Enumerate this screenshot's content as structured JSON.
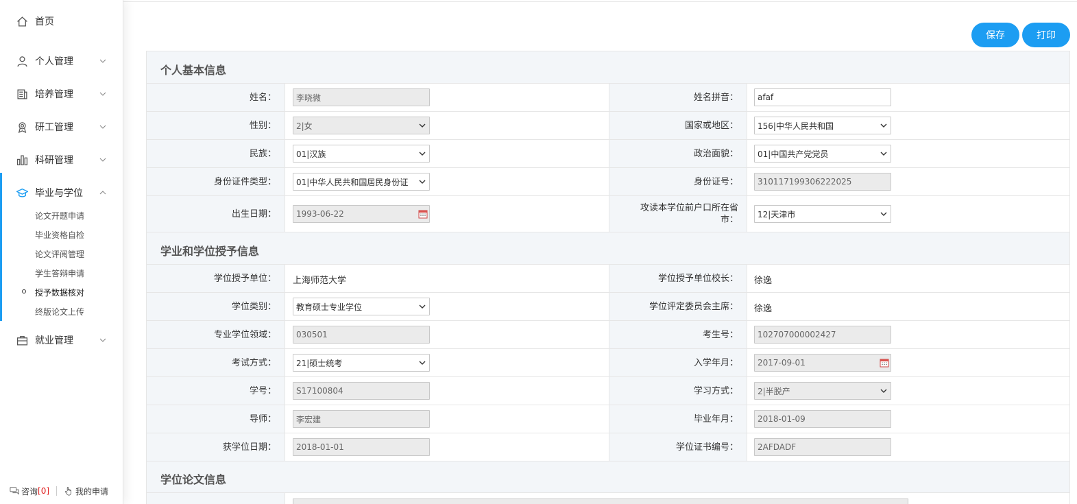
{
  "sidebar": {
    "home": "首页",
    "menus": [
      {
        "label": "个人管理",
        "icon": "user-icon"
      },
      {
        "label": "培养管理",
        "icon": "book-icon"
      },
      {
        "label": "研工管理",
        "icon": "award-icon"
      },
      {
        "label": "科研管理",
        "icon": "bar-chart-icon"
      },
      {
        "label": "毕业与学位",
        "icon": "graduation-cap-icon"
      },
      {
        "label": "就业管理",
        "icon": "briefcase-icon"
      }
    ],
    "sub_items": [
      "论文开题申请",
      "毕业资格自检",
      "论文评阅管理",
      "学生答辩申请",
      "授予数据核对",
      "终版论文上传"
    ],
    "active_sub": "授予数据核对",
    "footer": {
      "consult": "咨询",
      "consult_count": "[0]",
      "my_apply": "我的申请"
    }
  },
  "toolbar": {
    "save": "保存",
    "print": "打印"
  },
  "sections": {
    "basic": "个人基本信息",
    "degree": "学业和学位授予信息",
    "thesis": "学位论文信息"
  },
  "basic": {
    "name_label": "姓名：",
    "name": "李晓微",
    "pinyin_label": "姓名拼音：",
    "pinyin": "afaf",
    "gender_label": "性别：",
    "gender": "2|女",
    "country_label": "国家或地区：",
    "country": "156|中华人民共和国",
    "ethnic_label": "民族：",
    "ethnic": "01|汉族",
    "political_label": "政治面貌：",
    "political": "01|中国共产党党员",
    "idtype_label": "身份证件类型：",
    "idtype": "01|中华人民共和国居民身份证",
    "idno_label": "身份证号：",
    "idno": "310117199306222025",
    "birth_label": "出生日期：",
    "birth": "1993-06-22",
    "hukou_label": "攻读本学位前户口所在省市：",
    "hukou": "12|天津市"
  },
  "degree": {
    "unit_label": "学位授予单位：",
    "unit": "上海师范大学",
    "president_label": "学位授予单位校长：",
    "president": "徐逸",
    "type_label": "学位类别：",
    "type": "教育硕士专业学位",
    "chair_label": "学位评定委员会主席：",
    "chair": "徐逸",
    "field_label": "专业学位领域：",
    "field": "030501",
    "examno_label": "考生号：",
    "examno": "102707000002427",
    "exammode_label": "考试方式：",
    "exammode": "21|硕士统考",
    "enroll_label": "入学年月：",
    "enroll": "2017-09-01",
    "sid_label": "学号：",
    "sid": "S17100804",
    "studymode_label": "学习方式：",
    "studymode": "2|半脱产",
    "tutor_label": "导师：",
    "tutor": "李宏建",
    "gradmonth_label": "毕业年月：",
    "gradmonth": "2018-01-09",
    "degreedate_label": "获学位日期：",
    "degreedate": "2018-01-01",
    "certno_label": "学位证书编号：",
    "certno": "2AFDADF"
  },
  "colors": {
    "accent": "#1c9df2",
    "label_bg": "#f3f6f9",
    "readonly_bg": "#ebebeb"
  }
}
